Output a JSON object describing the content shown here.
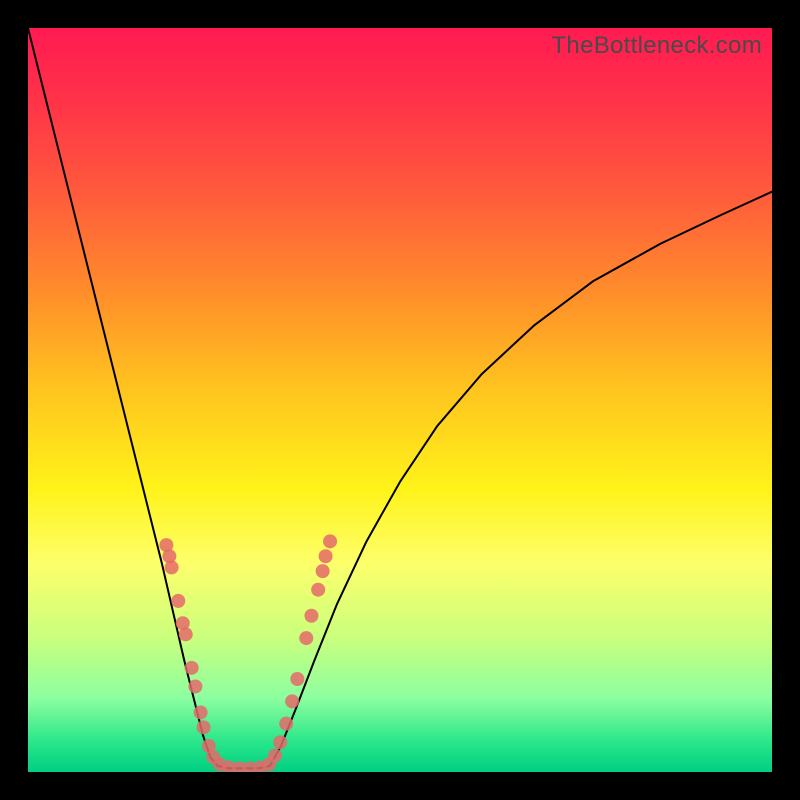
{
  "watermark": "TheBottleneck.com",
  "colors": {
    "curve_stroke": "#000000",
    "dot_fill": "#e46a6a",
    "dot_fill_alpha": 0.85
  },
  "chart_data": {
    "type": "line",
    "title": "",
    "xlabel": "",
    "ylabel": "",
    "xlim": [
      0,
      100
    ],
    "ylim": [
      0,
      100
    ],
    "series": [
      {
        "name": "left-curve",
        "x": [
          0.0,
          2.0,
          4.0,
          6.0,
          8.0,
          10.0,
          12.0,
          14.0,
          16.0,
          18.0,
          19.5,
          21.0,
          22.5,
          23.5,
          24.5,
          25.5
        ],
        "y": [
          100.0,
          92.0,
          84.0,
          76.0,
          68.0,
          60.0,
          52.0,
          44.0,
          36.0,
          28.0,
          21.5,
          15.0,
          9.0,
          5.0,
          2.0,
          0.8
        ]
      },
      {
        "name": "valley-floor",
        "x": [
          25.5,
          27.0,
          29.0,
          31.0,
          32.5
        ],
        "y": [
          0.8,
          0.5,
          0.5,
          0.5,
          0.8
        ]
      },
      {
        "name": "right-curve",
        "x": [
          32.5,
          34.0,
          36.0,
          38.5,
          41.5,
          45.5,
          50.0,
          55.0,
          61.0,
          68.0,
          76.0,
          85.0,
          93.0,
          100.0
        ],
        "y": [
          0.8,
          3.5,
          8.5,
          15.0,
          22.5,
          31.0,
          39.0,
          46.5,
          53.5,
          60.0,
          66.0,
          71.0,
          74.8,
          78.0
        ]
      }
    ],
    "dots": [
      {
        "x": 18.6,
        "y": 30.5
      },
      {
        "x": 19.0,
        "y": 29.0
      },
      {
        "x": 19.3,
        "y": 27.5
      },
      {
        "x": 20.2,
        "y": 23.0
      },
      {
        "x": 20.8,
        "y": 20.0
      },
      {
        "x": 21.2,
        "y": 18.5
      },
      {
        "x": 22.0,
        "y": 14.0
      },
      {
        "x": 22.5,
        "y": 11.5
      },
      {
        "x": 23.2,
        "y": 8.0
      },
      {
        "x": 23.6,
        "y": 6.0
      },
      {
        "x": 24.3,
        "y": 3.5
      },
      {
        "x": 24.9,
        "y": 2.0
      },
      {
        "x": 25.8,
        "y": 1.0
      },
      {
        "x": 27.0,
        "y": 0.6
      },
      {
        "x": 28.4,
        "y": 0.5
      },
      {
        "x": 29.8,
        "y": 0.5
      },
      {
        "x": 31.2,
        "y": 0.6
      },
      {
        "x": 32.4,
        "y": 1.0
      },
      {
        "x": 33.2,
        "y": 2.2
      },
      {
        "x": 33.9,
        "y": 4.0
      },
      {
        "x": 34.7,
        "y": 6.5
      },
      {
        "x": 35.5,
        "y": 9.5
      },
      {
        "x": 36.2,
        "y": 12.5
      },
      {
        "x": 37.4,
        "y": 18.0
      },
      {
        "x": 38.1,
        "y": 21.0
      },
      {
        "x": 39.0,
        "y": 24.5
      },
      {
        "x": 39.6,
        "y": 27.0
      },
      {
        "x": 40.0,
        "y": 29.0
      },
      {
        "x": 40.6,
        "y": 31.0
      }
    ],
    "dot_radius_px": 7
  }
}
